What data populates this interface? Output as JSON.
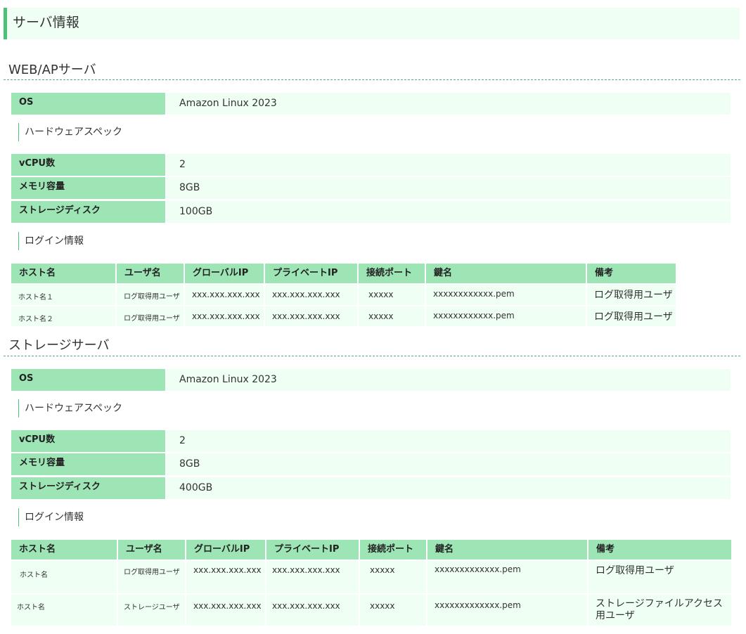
{
  "page_title": "サーバ情報",
  "sections": [
    {
      "title": "WEB/APサーバ",
      "os": {
        "label": "OS",
        "value": "Amazon Linux 2023"
      },
      "hw_heading": "ハードウェアスペック",
      "specs": [
        {
          "label": "vCPU数",
          "value": "2"
        },
        {
          "label": "メモリ容量",
          "value": "8GB"
        },
        {
          "label": "ストレージディスク",
          "value": "100GB"
        }
      ],
      "login_heading": "ログイン情報",
      "login_columns": [
        "ホスト名",
        "ユーザ名",
        "グローバルIP",
        "プライベートIP",
        "接続ポート",
        "鍵名",
        "備考"
      ],
      "login_rows": [
        [
          "ホスト名１",
          "ログ取得用ユーザ",
          "xxx.xxx.xxx.xxx",
          "xxx.xxx.xxx.xxx",
          "xxxxx",
          "xxxxxxxxxxxx.pem",
          "ログ取得用ユーザ"
        ],
        [
          "ホスト名２",
          "ログ取得用ユーザ",
          "xxx.xxx.xxx.xxx",
          "xxx.xxx.xxx.xxx",
          "xxxxx",
          "xxxxxxxxxxxx.pem",
          "ログ取得用ユーザ"
        ]
      ]
    },
    {
      "title": "ストレージサーバ",
      "os": {
        "label": "OS",
        "value": "Amazon Linux 2023"
      },
      "hw_heading": "ハードウェアスペック",
      "specs": [
        {
          "label": "vCPU数",
          "value": "2"
        },
        {
          "label": "メモリ容量",
          "value": "8GB"
        },
        {
          "label": "ストレージディスク",
          "value": "400GB"
        }
      ],
      "login_heading": "ログイン情報",
      "login_columns": [
        "ホスト名",
        "ユーザ名",
        "グローバルIP",
        "プライベートIP",
        "接続ポート",
        "鍵名",
        "備考"
      ],
      "login_rows": [
        [
          "ホスト名",
          "ログ取得用ユーザ",
          "xxx.xxx.xxx.xxx",
          "xxx.xxx.xxx.xxx",
          "xxxxx",
          "xxxxxxxxxxxxx.pem",
          "ログ取得用ユーザ"
        ],
        [
          "ホスト名",
          "ストレージユーザ",
          "xxx.xxx.xxx.xxx",
          "xxx.xxx.xxx.xxx",
          "xxxxx",
          "xxxxxxxxxxxxx.pem",
          "ストレージファイルアクセス用ユーザ"
        ]
      ]
    }
  ]
}
